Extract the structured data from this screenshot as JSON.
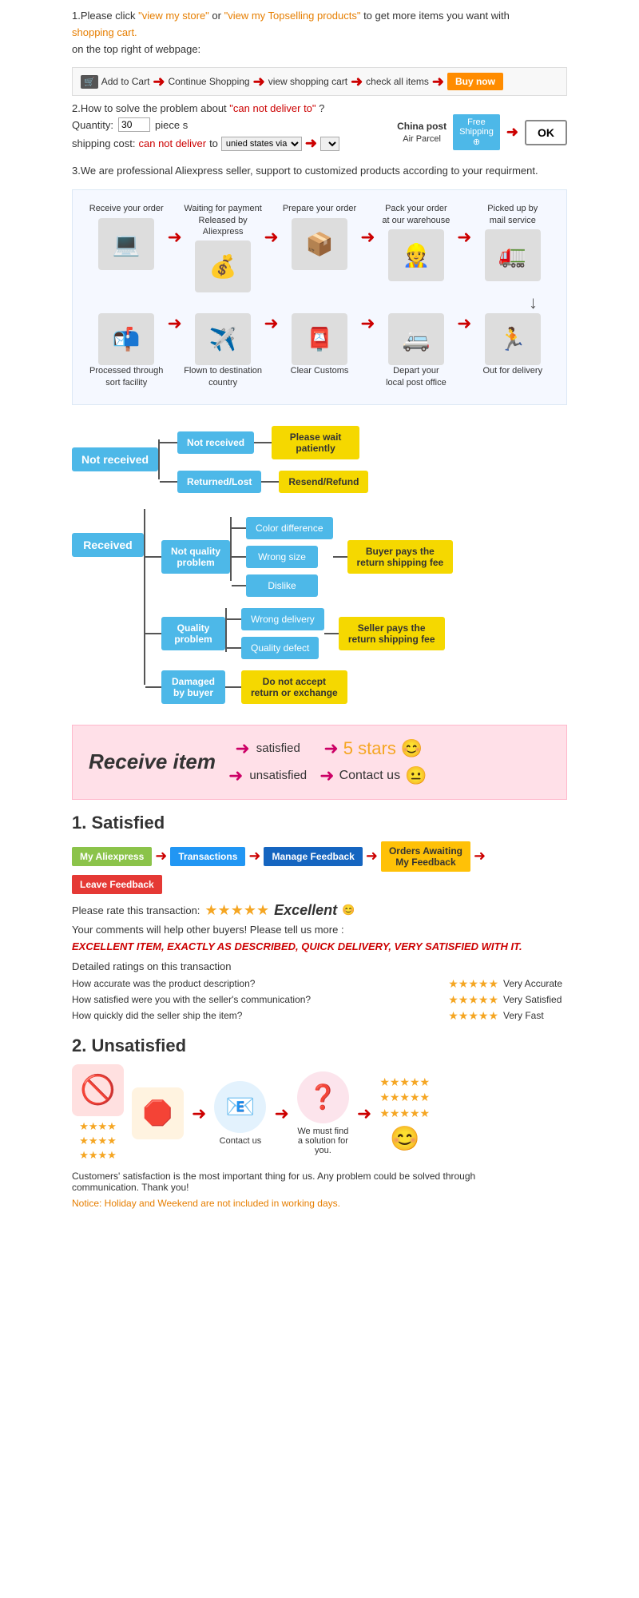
{
  "section1": {
    "text1": "1.Please click ",
    "link1": "\"view my store\"",
    "text2": "or ",
    "link2": "\"view my Topselling products\"",
    "text3": " to get more items you want with",
    "text4": "shopping cart.",
    "text5": "on the top right of webpage:"
  },
  "cart_steps": {
    "steps": [
      {
        "label": "Add to Cart",
        "icon": "🛒"
      },
      {
        "label": "Continue Shopping"
      },
      {
        "label": "view shopping cart"
      },
      {
        "label": "check all items"
      },
      {
        "label": "Buy now"
      }
    ]
  },
  "section2": {
    "title": "2.How to solve the problem about",
    "cannot": "\"can not deliver to\"",
    "suffix": "?",
    "qty_label": "Quantity:",
    "qty_value": "30",
    "qty_unit": "piece s",
    "ship_label": "shipping cost:",
    "ship_cannot": "can not deliver",
    "ship_to": " to ",
    "ship_via": "unied states via",
    "china_post_title": "China post",
    "china_post_sub": "Air Parcel",
    "free_shipping": "Free\nShipping",
    "ok_label": "OK"
  },
  "section3": {
    "text": "3.We are professional Aliexpress seller, support to customized products according to your requirment."
  },
  "process": {
    "top_steps": [
      {
        "label": "Receive your order",
        "icon": "💻"
      },
      {
        "label": "Waiting for payment\nReleased by Aliexpress",
        "icon": "💰"
      },
      {
        "label": "Prepare your order",
        "icon": "📦"
      },
      {
        "label": "Pack your order\nat our warehouse",
        "icon": "👷"
      },
      {
        "label": "Picked up by\nmail service",
        "icon": "🚛"
      }
    ],
    "bottom_steps": [
      {
        "label": "Out for delivery",
        "icon": "🏃"
      },
      {
        "label": "Depart your\nlocal post office",
        "icon": "🚐"
      },
      {
        "label": "Clear Customs",
        "icon": "📮"
      },
      {
        "label": "Flown to destination\ncountry",
        "icon": "✈️"
      },
      {
        "label": "Processed through\nsort facility",
        "icon": "📬"
      }
    ]
  },
  "resolution": {
    "not_received_label": "Not received",
    "not_received_sub": [
      {
        "label": "Not received",
        "result": "Please wait\npatiently"
      },
      {
        "label": "Returned/Lost",
        "result": "Resend/Refund"
      }
    ],
    "received_label": "Received",
    "received_sub": [
      {
        "label": "Not quality\nproblem",
        "items": [
          "Color difference",
          "Wrong size",
          "Dislike"
        ],
        "result": "Buyer pays the\nreturn shipping fee"
      },
      {
        "label": "Quality\nproblem",
        "items": [
          "Wrong delivery",
          "Quality defect"
        ],
        "result": "Seller pays the\nreturn shipping fee"
      },
      {
        "label": "Damaged\nby buyer",
        "items": [],
        "result": "Do not accept\nreturn or exchange"
      }
    ]
  },
  "receive_item": {
    "title": "Receive item",
    "outcomes": [
      {
        "label": "satisfied",
        "result": "5 stars",
        "emoji": "😊"
      },
      {
        "label": "unsatisfied",
        "result": "Contact us",
        "emoji": "😐"
      }
    ]
  },
  "satisfied": {
    "title": "1. Satisfied",
    "steps": [
      {
        "label": "My Aliexpress",
        "style": "green"
      },
      {
        "label": "Transactions",
        "style": "blue"
      },
      {
        "label": "Manage Feedback",
        "style": "blue2"
      },
      {
        "label": "Orders Awaiting\nMy Feedback",
        "style": "yellow"
      },
      {
        "label": "Leave Feedback",
        "style": "red"
      }
    ],
    "rate_label": "Please rate this transaction:",
    "stars": "★★★★★",
    "excellent": "Excellent",
    "emoji": "😊",
    "comments": "Your comments will help other buyers! Please tell us more :",
    "feedback_text": "EXCELLENT ITEM, EXACTLY AS DESCRIBED, QUICK DELIVERY, VERY SATISFIED WITH IT.",
    "detail_title": "Detailed ratings on this transaction",
    "details": [
      {
        "label": "How accurate was the product description?",
        "stars": "★★★★★",
        "result": "Very Accurate"
      },
      {
        "label": "How satisfied were you with the seller's communication?",
        "stars": "★★★★★",
        "result": "Very Satisfied"
      },
      {
        "label": "How quickly did the seller ship the item?",
        "stars": "★★★★★",
        "result": "Very Fast"
      }
    ]
  },
  "unsatisfied": {
    "title": "2. Unsatisfied",
    "flow": [
      {
        "type": "no-icon",
        "label": "",
        "stars": "★★★★\n★★★★\n★★★★"
      },
      {
        "type": "stop-icon",
        "label": ""
      },
      {
        "type": "email-icon",
        "label": "Contact us"
      },
      {
        "type": "question-icon",
        "label": "We must find\na solution for\nyou."
      },
      {
        "type": "stars-smiley",
        "label": "",
        "stars": "★★★★★\n★★★★★\n★★★★★"
      }
    ],
    "notice1": "Customers' satisfaction is the most important thing for us. Any problem could be solved through",
    "notice2": "communication. Thank you!",
    "notice3": "Notice: Holiday and Weekend are not included in working days."
  }
}
